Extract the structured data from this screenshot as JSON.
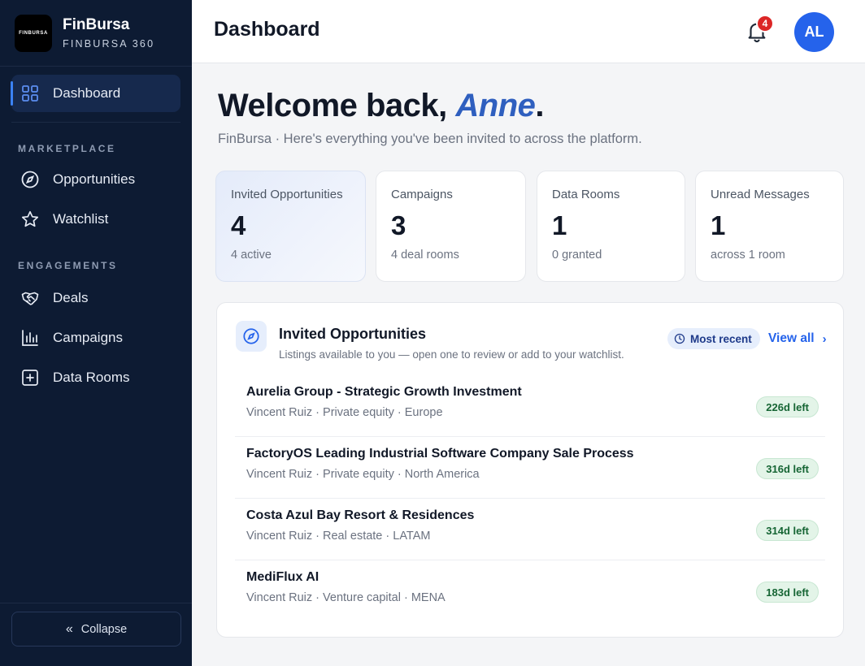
{
  "brand": {
    "logo_text": "FINBURSA",
    "name": "FinBursa",
    "subtitle": "FINBURSA 360"
  },
  "sidebar": {
    "dashboard": {
      "label": "Dashboard",
      "icon": "grid-icon",
      "active": true
    },
    "sections": [
      {
        "label": "MARKETPLACE",
        "items": [
          {
            "label": "Opportunities",
            "icon": "compass-icon"
          },
          {
            "label": "Watchlist",
            "icon": "star-icon"
          }
        ]
      },
      {
        "label": "ENGAGEMENTS",
        "items": [
          {
            "label": "Deals",
            "icon": "handshake-icon"
          },
          {
            "label": "Campaigns",
            "icon": "bar-chart-icon"
          },
          {
            "label": "Data Rooms",
            "icon": "plus-square-icon"
          }
        ]
      }
    ],
    "collapse_label": "Collapse"
  },
  "header": {
    "title": "Dashboard",
    "notification_count": "4",
    "avatar_initials": "AL"
  },
  "welcome": {
    "prefix": "Welcome back, ",
    "name": "Anne",
    "suffix": ".",
    "subtitle": "FinBursa · Here's everything you've been invited to across the platform."
  },
  "stats": [
    {
      "label": "Invited Opportunities",
      "value": "4",
      "sub": "4 active"
    },
    {
      "label": "Campaigns",
      "value": "3",
      "sub": "4 deal rooms"
    },
    {
      "label": "Data Rooms",
      "value": "1",
      "sub": "0 granted"
    },
    {
      "label": "Unread Messages",
      "value": "1",
      "sub": "across 1 room"
    }
  ],
  "panel": {
    "title": "Invited Opportunities",
    "subtitle": "Listings available to you — open one to review or add to your watchlist.",
    "sort_label": "Most recent",
    "view_all_label": "View all",
    "rows": [
      {
        "title": "Aurelia Group - Strategic Growth Investment",
        "meta": "Vincent Ruiz · Private equity · Europe",
        "days_left": "226d left"
      },
      {
        "title": "FactoryOS Leading Industrial Software Company Sale Process",
        "meta": "Vincent Ruiz · Private equity · North America",
        "days_left": "316d left"
      },
      {
        "title": "Costa Azul Bay Resort & Residences",
        "meta": "Vincent Ruiz · Real estate · LATAM",
        "days_left": "314d left"
      },
      {
        "title": "MediFlux AI",
        "meta": "Vincent Ruiz · Venture capital · MENA",
        "days_left": "183d left"
      }
    ]
  },
  "colors": {
    "sidebar_bg": "#0d1b33",
    "accent": "#2563eb",
    "name_accent": "#2f5fbf",
    "badge_red": "#dc2626",
    "success_green": "#166534"
  }
}
